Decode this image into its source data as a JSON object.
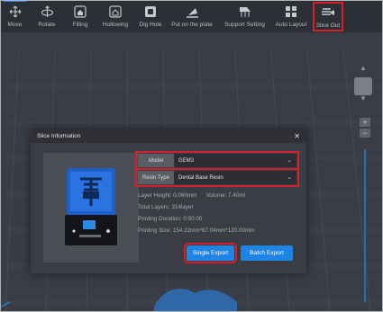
{
  "toolbar": {
    "items": [
      {
        "label": "Move",
        "icon": "move-icon"
      },
      {
        "label": "Rotate",
        "icon": "rotate-icon"
      },
      {
        "label": "Filling",
        "icon": "filling-icon"
      },
      {
        "label": "Hollowing",
        "icon": "hollowing-icon"
      },
      {
        "label": "Dig Hole",
        "icon": "dig-hole-icon"
      },
      {
        "label": "Put on the plate",
        "icon": "put-on-plate-icon"
      },
      {
        "label": "Support Setting",
        "icon": "support-setting-icon"
      },
      {
        "label": "Auto Layout",
        "icon": "auto-layout-icon"
      },
      {
        "label": "Slice Out",
        "icon": "slice-out-icon"
      }
    ]
  },
  "viewport": {
    "zoom_in": "+",
    "zoom_out": "−"
  },
  "dialog": {
    "title": "Slice Information",
    "close": "✕",
    "model_label": "Model",
    "model_value": "GEM3",
    "resin_label": "Resin Type",
    "resin_value": "Dental Base Resin",
    "layer_height": "Layer Height: 0.060mm",
    "volume": "Volume: 7.40ml",
    "total_layers": "Total Layers: 314layer",
    "printing_duration": "Printing Duration: 0:50:00",
    "printing_size": "Printing Size: 154.22mm*87.04mm*120.00mm",
    "single_export": "Single Export",
    "batch_export": "Batch Export"
  },
  "colors": {
    "accent": "#1e84e6",
    "highlight": "#d5202c",
    "toolbar_bg": "#2c2f35",
    "viewport_bg": "#3a3d45"
  }
}
